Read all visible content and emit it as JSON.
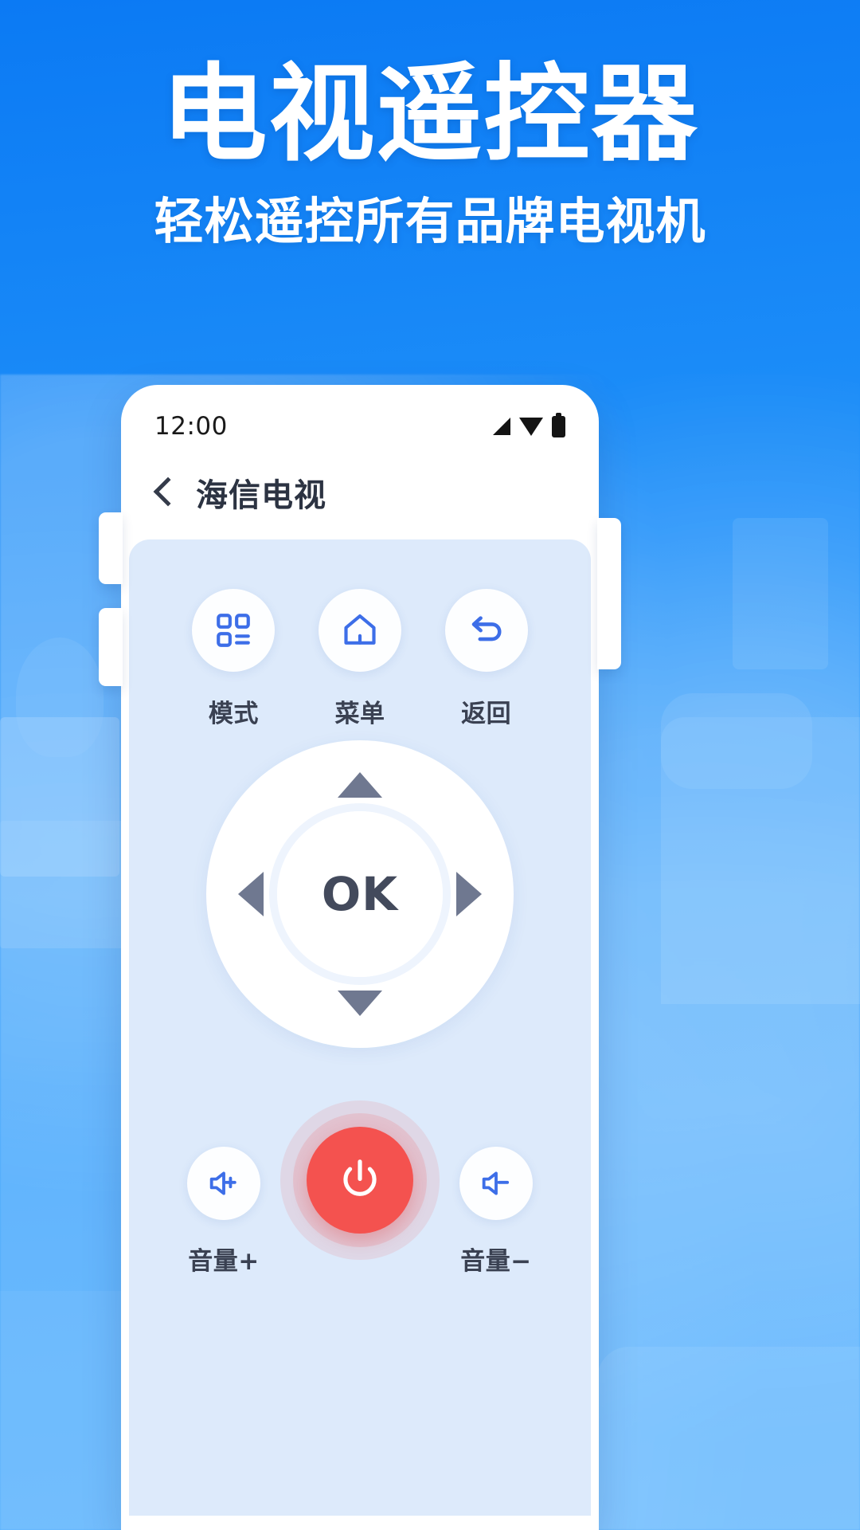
{
  "promo": {
    "title": "电视遥控器",
    "subtitle": "轻松遥控所有品牌电视机",
    "background_color": "#1b8cf8",
    "title_color": "#ffffff"
  },
  "phone": {
    "status_bar": {
      "time": "12:00",
      "icons": [
        "signal-icon",
        "wifi-icon",
        "battery-icon"
      ]
    },
    "app_header": {
      "back_icon": "chevron-left-icon",
      "title": "海信电视"
    },
    "remote": {
      "panel_color": "#ddeafb",
      "accent_color": "#3d6ee8",
      "top_buttons": [
        {
          "label": "模式",
          "icon": "apps-grid-icon"
        },
        {
          "label": "菜单",
          "icon": "home-icon"
        },
        {
          "label": "返回",
          "icon": "back-arrow-icon"
        }
      ],
      "dpad": {
        "ok_label": "OK",
        "up_icon": "triangle-up-icon",
        "down_icon": "triangle-down-icon",
        "left_icon": "triangle-left-icon",
        "right_icon": "triangle-right-icon",
        "arrow_color": "#6f7890"
      },
      "bottom_controls": {
        "volume_up": {
          "label": "音量+",
          "icon": "volume-up-icon"
        },
        "power": {
          "icon": "power-icon",
          "color": "#f4524f"
        },
        "volume_down": {
          "label": "音量−",
          "icon": "volume-down-icon"
        }
      }
    }
  }
}
